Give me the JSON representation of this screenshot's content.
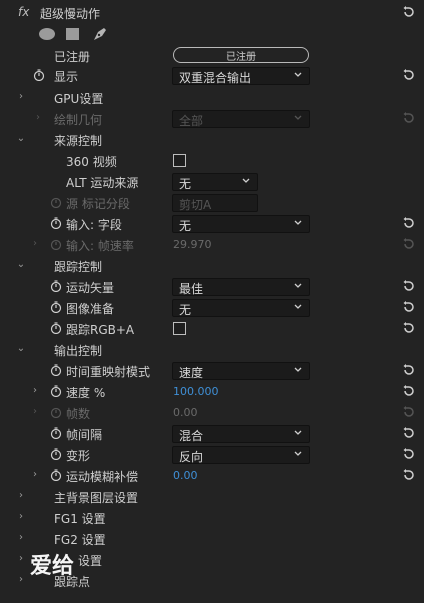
{
  "header": {
    "fx": "fx",
    "title": "超级慢动作"
  },
  "registered": {
    "label": "已注册",
    "button": "已注册"
  },
  "display": {
    "label": "显示",
    "value": "双重混合输出"
  },
  "gpu": {
    "label": "GPU设置"
  },
  "draw": {
    "label": "绘制几何",
    "value": "全部"
  },
  "source": {
    "label": "来源控制",
    "video360": "360 视频",
    "alt": "ALT 运动来源",
    "alt_value": "无",
    "src_tag": "源 标记分段",
    "src_tag_value": "剪切A",
    "input_field": "输入: 字段",
    "input_field_value": "无",
    "input_rate": "输入: 帧速率",
    "input_rate_value": "29.970"
  },
  "tracking": {
    "label": "跟踪控制",
    "vector": "运动矢量",
    "vector_value": "最佳",
    "prep": "图像准备",
    "prep_value": "无",
    "rgba": "跟踪RGB+A"
  },
  "output": {
    "label": "输出控制",
    "remap": "时间重映射模式",
    "remap_value": "速度",
    "speed": "速度 %",
    "speed_value": "100.000",
    "frames": "帧数",
    "frames_value": "0.00",
    "interval": "帧间隔",
    "interval_value": "混合",
    "warp": "变形",
    "warp_value": "反向",
    "motion_blur": "运动模糊补偿",
    "motion_blur_value": "0.00"
  },
  "sections": {
    "bg": "主背景图层设置",
    "fg1": "FG1 设置",
    "fg2": "FG2 设置",
    "matte": "设置",
    "track": "跟踪点"
  },
  "watermark": "爱给"
}
